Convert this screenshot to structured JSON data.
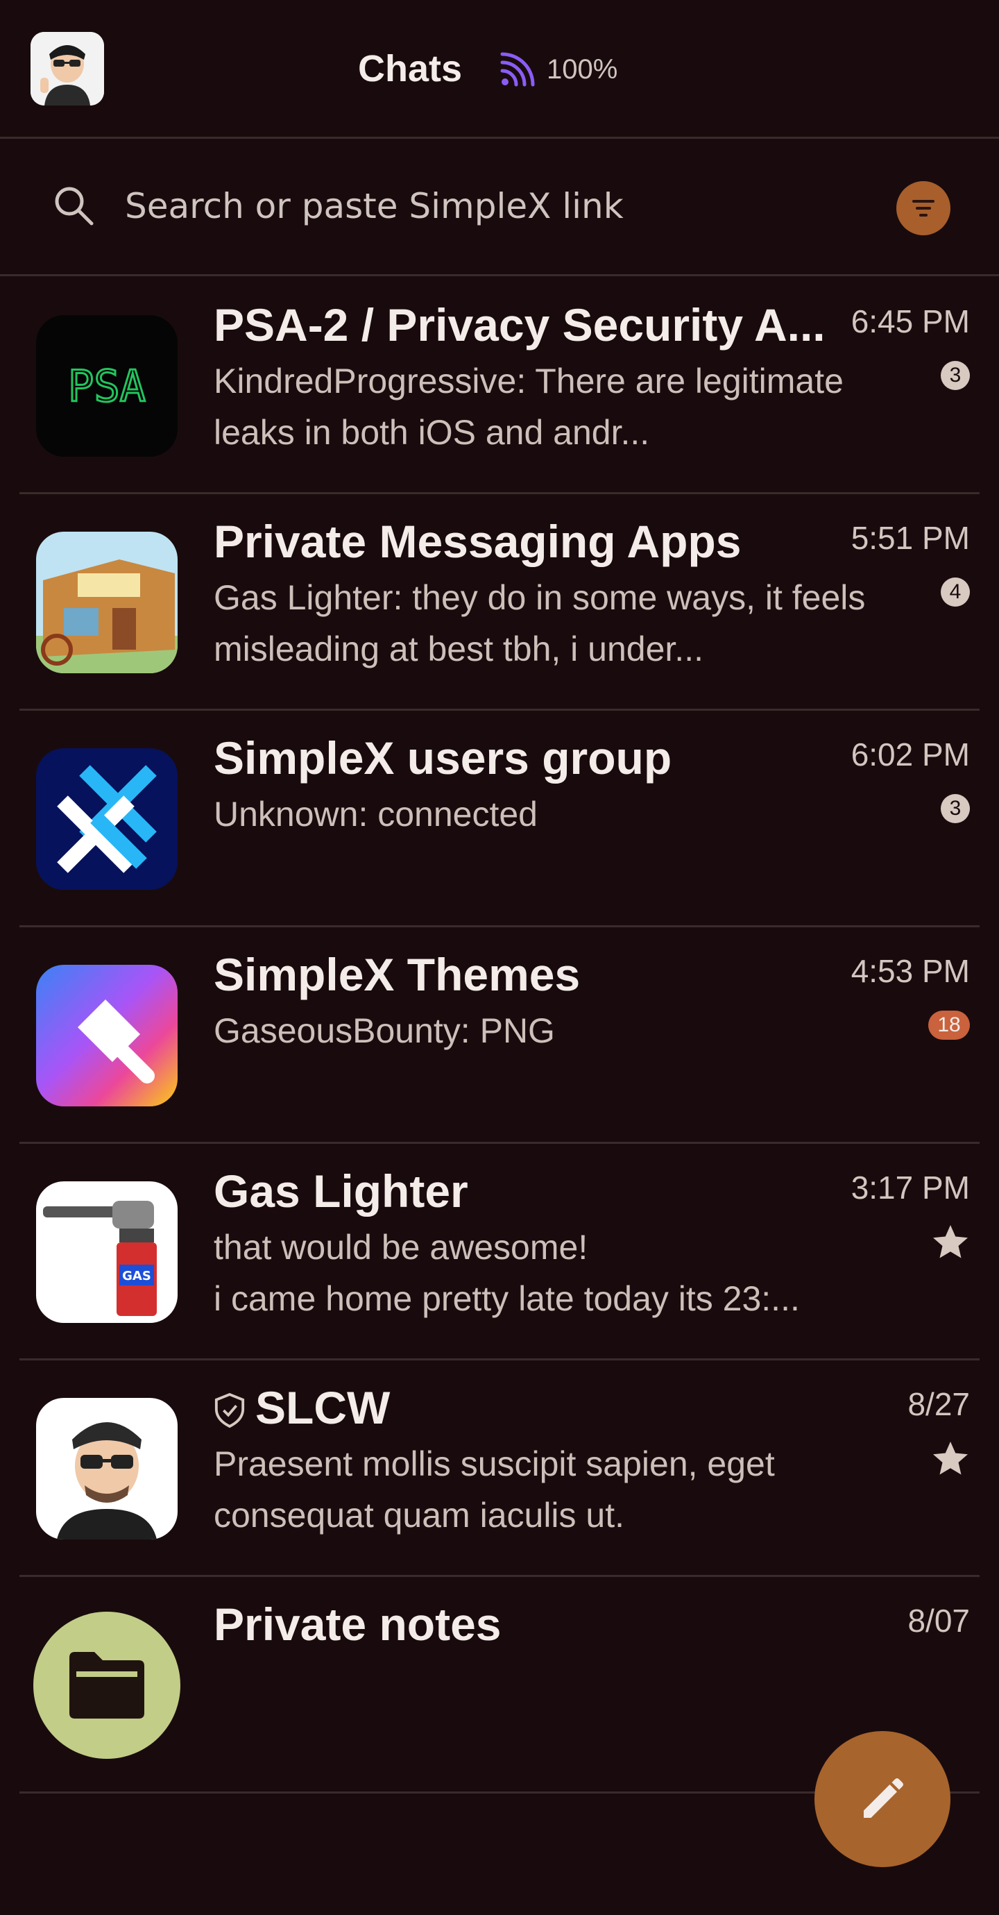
{
  "header": {
    "title": "Chats",
    "network_status": "100%"
  },
  "search": {
    "placeholder": "Search or paste SimpleX link"
  },
  "colors": {
    "background": "#190b0d",
    "accent": "#a8642d",
    "network_icon": "#8b5cf6",
    "badge_hot": "#c9623d"
  },
  "chats": [
    {
      "name": "PSA-2 / Privacy Security A...",
      "time": "6:45 PM",
      "sender": "KindredProgressive:",
      "preview": "There are legitimate leaks in both iOS and andr...",
      "badge": "3",
      "icon": "psa-logo"
    },
    {
      "name": "Private Messaging Apps",
      "time": "5:51 PM",
      "sender": "Gas Lighter:",
      "preview": "they do in some ways, it feels misleading at best tbh, i under...",
      "badge": "4",
      "icon": "store-illustration"
    },
    {
      "name": "SimpleX users group",
      "time": "6:02 PM",
      "sender": "Unknown:",
      "preview": "connected",
      "badge": "3",
      "icon": "simplex-logo"
    },
    {
      "name": "SimpleX Themes",
      "time": "4:53 PM",
      "sender": "GaseousBounty:",
      "preview": "PNG",
      "badge": "18",
      "icon": "paintbrush-logo"
    },
    {
      "name": "Gas Lighter",
      "time": "3:17 PM",
      "sender": "",
      "preview_line1": "that would be awesome!",
      "preview_line2": "i came home pretty late today its 23:...",
      "starred": true,
      "icon": "gas-torch"
    },
    {
      "name": "SLCW",
      "time": "8/27",
      "sender": "",
      "preview": "Praesent mollis suscipit sapien, eget consequat quam iaculis ut.",
      "starred": true,
      "icon": "avatar-cartoon",
      "verified": true
    },
    {
      "name": "Private notes",
      "time": "8/07",
      "preview": "",
      "icon": "folder-icon"
    }
  ]
}
